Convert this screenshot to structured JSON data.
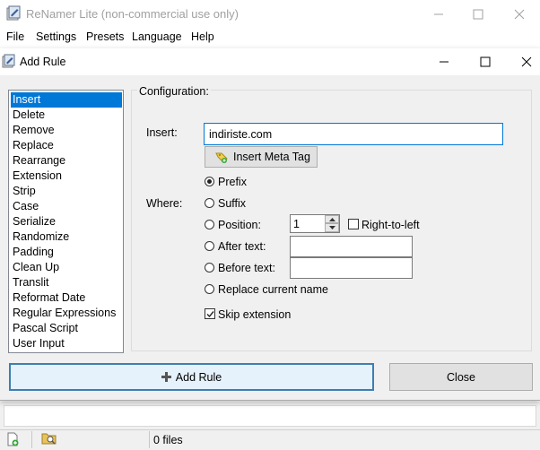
{
  "main_window": {
    "title": "ReNamer Lite (non-commercial use only)",
    "menu": [
      "File",
      "Settings",
      "Presets",
      "Language",
      "Help"
    ],
    "status": "0 files"
  },
  "dialog": {
    "title": "Add Rule",
    "rules": [
      "Insert",
      "Delete",
      "Remove",
      "Replace",
      "Rearrange",
      "Extension",
      "Strip",
      "Case",
      "Serialize",
      "Randomize",
      "Padding",
      "Clean Up",
      "Translit",
      "Reformat Date",
      "Regular Expressions",
      "Pascal Script",
      "User Input"
    ],
    "selected_rule": "Insert",
    "configuration_label": "Configuration:",
    "insert_label": "Insert:",
    "insert_value": "indiriste.com",
    "insert_meta_tag_label": "Insert Meta Tag",
    "where_label": "Where:",
    "options": {
      "prefix": "Prefix",
      "suffix": "Suffix",
      "position": "Position:",
      "after_text": "After text:",
      "before_text": "Before text:",
      "replace_current_name": "Replace current name"
    },
    "selected_option": "prefix",
    "position_value": "1",
    "right_to_left_label": "Right-to-left",
    "right_to_left_checked": false,
    "skip_extension_label": "Skip extension",
    "skip_extension_checked": true,
    "add_rule_button": "Add Rule",
    "close_button": "Close"
  },
  "colors": {
    "selection": "#0078d7",
    "focus_border": "#3c7fb1"
  }
}
